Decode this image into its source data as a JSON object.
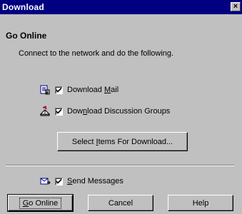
{
  "window": {
    "title": "Download",
    "close_symbol": "×"
  },
  "dialog": {
    "heading": "Go Online",
    "description": "Connect to the network and do the following."
  },
  "options": [
    {
      "label_pre": "Download ",
      "label_u": "M",
      "label_post": "ail",
      "checked": true,
      "icon": "mail-icon"
    },
    {
      "label_pre": "Dow",
      "label_u": "n",
      "label_post": "load Discussion Groups",
      "checked": true,
      "icon": "discussion-icon"
    },
    {
      "label_pre": "",
      "label_u": "S",
      "label_post": "end Messages",
      "checked": true,
      "icon": "send-icon"
    }
  ],
  "select_items": {
    "label_pre": "Select ",
    "label_u": "I",
    "label_post": "tems For Download..."
  },
  "buttons": {
    "go_online": {
      "label_u": "G",
      "label_post": "o Online"
    },
    "cancel": "Cancel",
    "help": "Help"
  },
  "colors": {
    "titlebar": "#000080",
    "face": "#c0c0c0"
  }
}
